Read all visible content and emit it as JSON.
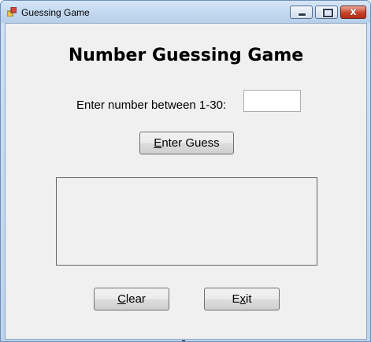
{
  "window": {
    "title": "Guessing Game",
    "icon": "app-icon",
    "controls": {
      "minimize_icon": "minimize-icon",
      "maximize_icon": "maximize-icon",
      "close_icon": "close-icon",
      "close_glyph": "x"
    }
  },
  "form": {
    "heading": "Number Guessing Game",
    "prompt_label": "Enter number between 1-30:",
    "guess_input": {
      "value": "",
      "placeholder": ""
    },
    "enter_button": {
      "mnemonic": "E",
      "rest": "nter Guess"
    },
    "output_box": {
      "text": ""
    },
    "clear_button": {
      "mnemonic": "C",
      "rest": "lear"
    },
    "exit_button": {
      "pre": "E",
      "mnemonic": "x",
      "rest": "it"
    }
  },
  "colors": {
    "client_background": "#f0f0f0",
    "title_bar": "#c4d9f1",
    "close_button": "#c7432c"
  }
}
